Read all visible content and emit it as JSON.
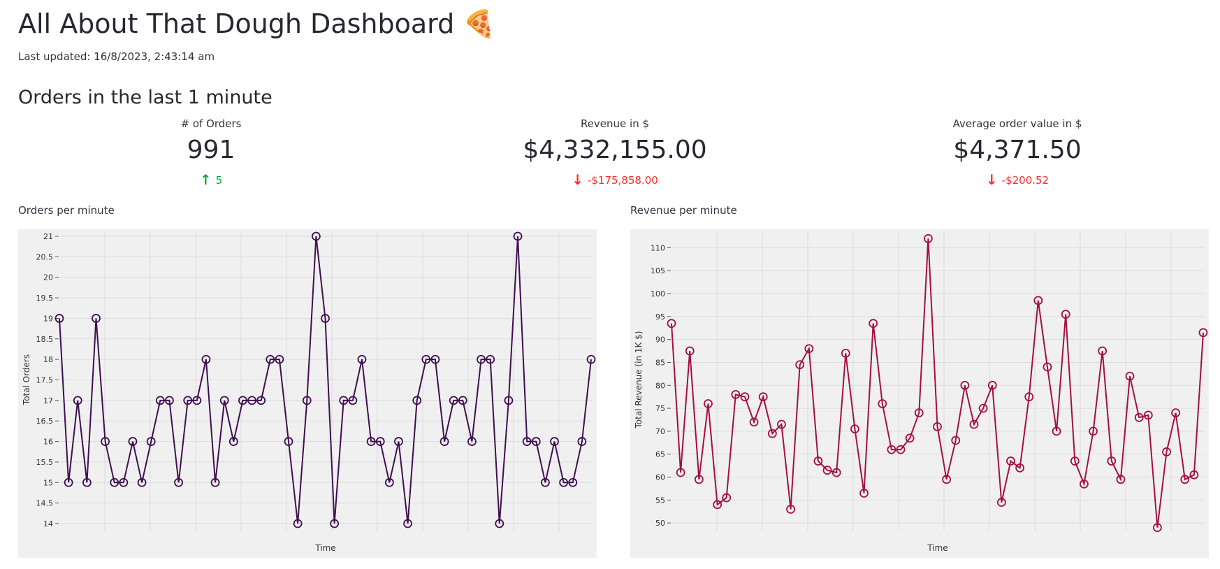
{
  "header": {
    "title": "All About That Dough Dashboard 🍕",
    "last_updated": "Last updated: 16/8/2023, 2:43:14 am"
  },
  "section": {
    "title": "Orders in the last 1 minute"
  },
  "metrics": [
    {
      "label": "# of Orders",
      "value": "991",
      "delta": "5",
      "direction": "up"
    },
    {
      "label": "Revenue in $",
      "value": "$4,332,155.00",
      "delta": "-$175,858.00",
      "direction": "down"
    },
    {
      "label": "Average order value in $",
      "value": "$4,371.50",
      "delta": "-$200.52",
      "direction": "down"
    }
  ],
  "colors": {
    "orders_line": "#3f0f4f",
    "revenue_line": "#a50f3f",
    "up": "#09ab3b",
    "down": "#ff2b2b"
  },
  "chart_data": [
    {
      "type": "line",
      "title": "Orders per minute",
      "xlabel": "Time",
      "ylabel": "Total Orders",
      "ylim": [
        14,
        21
      ],
      "yticks": [
        14,
        14.5,
        15,
        15.5,
        16,
        16.5,
        17,
        17.5,
        18,
        18.5,
        19,
        19.5,
        20,
        20.5,
        21
      ],
      "grid": true,
      "series": [
        {
          "values": [
            19,
            15,
            17,
            15,
            19,
            16,
            15,
            15,
            16,
            15,
            16,
            17,
            17,
            15,
            17,
            17,
            18,
            15,
            17,
            16,
            17,
            17,
            17,
            18,
            18,
            16,
            14,
            17,
            21,
            19,
            14,
            17,
            17,
            18,
            16,
            16,
            15,
            16,
            14,
            17,
            18,
            18,
            16,
            17,
            17,
            16,
            18,
            18,
            14,
            17,
            21,
            16,
            16,
            15,
            16,
            15,
            15,
            16,
            18
          ]
        }
      ]
    },
    {
      "type": "line",
      "title": "Revenue per minute",
      "xlabel": "Time",
      "ylabel": "Total Revenue (in 1K $)",
      "ylim": [
        50,
        110
      ],
      "yticks": [
        50,
        55,
        60,
        65,
        70,
        75,
        80,
        85,
        90,
        95,
        100,
        105,
        110
      ],
      "grid": true,
      "series": [
        {
          "values": [
            93.5,
            61,
            87.5,
            59.5,
            76,
            54,
            55.5,
            78,
            77.5,
            72,
            77.5,
            69.5,
            71.5,
            53,
            84.5,
            88,
            63.5,
            61.5,
            61,
            87,
            70.5,
            56.5,
            93.5,
            76,
            66,
            66,
            68.5,
            74,
            112,
            71,
            59.5,
            68,
            80,
            71.5,
            75,
            80,
            54.5,
            63.5,
            62,
            77.5,
            98.5,
            84,
            70,
            95.5,
            63.5,
            58.5,
            70,
            87.5,
            63.5,
            59.5,
            82,
            73,
            73.5,
            49,
            65.5,
            74,
            59.5,
            60.5,
            91.5
          ]
        }
      ]
    }
  ]
}
